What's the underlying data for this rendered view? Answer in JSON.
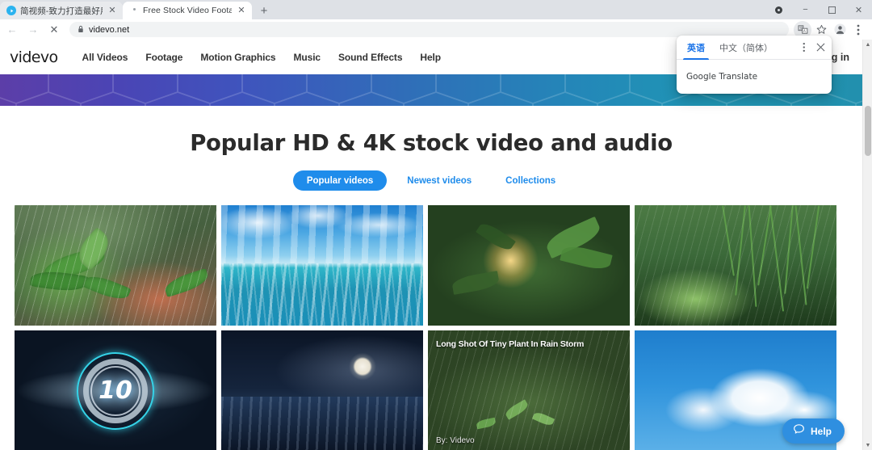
{
  "browser": {
    "tabs": [
      {
        "title": "简视频-致力打造最好用的视频创",
        "favicon": "play-circle-icon",
        "active": false
      },
      {
        "title": "Free Stock Video Footage HD",
        "favicon": "blank-icon",
        "active": true
      }
    ],
    "new_tab_label": "+",
    "window_controls": {
      "update_indicator": "update-dot-icon",
      "minimize": "−",
      "maximize": "❐",
      "close": "✕"
    },
    "toolbar": {
      "back": "←",
      "forward": "→",
      "stop": "✕",
      "lock_icon": "lock-icon",
      "url": "videvo.net",
      "translate_icon": "translate-icon",
      "bookmark_icon": "star-icon",
      "profile_icon": "person-icon",
      "menu_icon": "kebab-menu-icon"
    }
  },
  "translate_popup": {
    "tabs": [
      {
        "label": "英语",
        "selected": true
      },
      {
        "label": "中文（简体）",
        "selected": false
      }
    ],
    "more_icon": "kebab-menu-icon",
    "close_icon": "close-icon",
    "footer": "Google Translate"
  },
  "site": {
    "logo": "videvo",
    "nav": [
      {
        "label": "All Videos"
      },
      {
        "label": "Footage"
      },
      {
        "label": "Motion Graphics"
      },
      {
        "label": "Music"
      },
      {
        "label": "Sound Effects"
      },
      {
        "label": "Help"
      }
    ],
    "login_label": "Log in"
  },
  "main": {
    "heading": "Popular HD & 4K stock video and audio",
    "tabs": [
      {
        "label": "Popular videos",
        "active": true
      },
      {
        "label": "Newest videos",
        "active": false
      },
      {
        "label": "Collections",
        "active": false
      }
    ],
    "cards": [
      {
        "art": "leafrain",
        "title": "",
        "author": ""
      },
      {
        "art": "ocean",
        "title": "",
        "author": ""
      },
      {
        "art": "forest",
        "title": "",
        "author": ""
      },
      {
        "art": "willow",
        "title": "",
        "author": ""
      },
      {
        "art": "count",
        "title": "",
        "author": "",
        "countdown": "10"
      },
      {
        "art": "moon",
        "title": "",
        "author": ""
      },
      {
        "art": "forest2",
        "title": "Long Shot Of Tiny Plant In Rain Storm",
        "author": "By: Videvo"
      },
      {
        "art": "clouds2",
        "title": "",
        "author": ""
      }
    ]
  },
  "help_widget": {
    "label": "Help",
    "icon": "chat-bubble-icon"
  },
  "colors": {
    "accent_blue": "#1f8ceb",
    "google_blue": "#1a73e8",
    "help_blue": "#2f8fe0"
  }
}
